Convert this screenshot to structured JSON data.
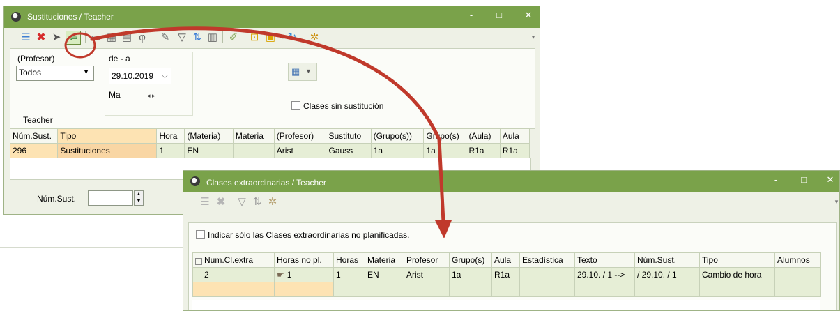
{
  "window1": {
    "title": "Sustituciones / Teacher",
    "controls": {
      "minimize": "-",
      "maximize": "□",
      "close": "✕"
    },
    "filter": {
      "profesor_label": "(Profesor)",
      "profesor_value": "Todos",
      "date_range_label": "de - a",
      "date_value": "29.10.2019",
      "day_label": "Ma",
      "day_arrows": "◂ ▸",
      "checkbox_label": "Clases sin sustitución",
      "section_label": "Teacher"
    },
    "table": {
      "headers": [
        "Núm.Sust.",
        "Tipo",
        "Hora",
        "(Materia)",
        "Materia",
        "(Profesor)",
        "Sustituto",
        "(Grupo(s))",
        "Grupo(s)",
        "(Aula)",
        "Aula"
      ],
      "rows": [
        [
          "296",
          "Sustituciones",
          "1",
          "EN",
          "",
          "Arist",
          "Gauss",
          "1a",
          "1a",
          "R1a",
          "R1a"
        ]
      ]
    },
    "footer": {
      "num_label": "Núm.Sust.",
      "num_value": ""
    }
  },
  "window2": {
    "title": "Clases extraordinarias / Teacher",
    "controls": {
      "minimize": "-",
      "maximize": "□",
      "close": "✕"
    },
    "checkbox_label": "Indicar sólo las Clases extraordinarias no planificadas.",
    "table": {
      "headers": [
        "Num.Cl.extra",
        "Horas no pl.",
        "Horas",
        "Materia",
        "Profesor",
        "Grupo(s)",
        "Aula",
        "Estadística",
        "Texto",
        "Núm.Sust.",
        "Tipo",
        "Alumnos"
      ],
      "rows": [
        [
          "2",
          "1",
          "1",
          "EN",
          "Arist",
          "1a",
          "R1a",
          "",
          "29.10. / 1 -->",
          "/ 29.10. / 1",
          "Cambio de hora",
          ""
        ]
      ]
    }
  },
  "colors": {
    "titlebar": "#7aa24a",
    "arrow": "#c0392b",
    "highlight": "#fde3b3"
  }
}
